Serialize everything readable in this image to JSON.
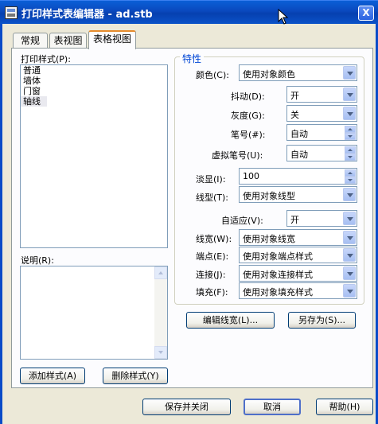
{
  "window": {
    "title": "打印样式表编辑器 - ad.stb",
    "help_glyph": "X"
  },
  "tabs": [
    {
      "label": "常规"
    },
    {
      "label": "表视图"
    },
    {
      "label": "表格视图",
      "active": true
    }
  ],
  "styles_panel": {
    "label": "打印样式(P):",
    "items": [
      "普通",
      "墙体",
      "门窗",
      "轴线"
    ],
    "selected": "轴线",
    "description_label": "说明(R):",
    "add_button": "添加样式(A)",
    "delete_button": "删除样式(Y)"
  },
  "properties": {
    "group_title": "特性",
    "color": {
      "label": "颜色(C):",
      "value": "使用对象颜色"
    },
    "dither": {
      "label": "抖动(D):",
      "value": "开"
    },
    "grayscale": {
      "label": "灰度(G):",
      "value": "关"
    },
    "pen_number": {
      "label": "笔号(#):",
      "value": "自动"
    },
    "virtual_pen": {
      "label": "虚拟笔号(U):",
      "value": "自动"
    },
    "screening": {
      "label": "淡显(I):",
      "value": "100"
    },
    "linetype": {
      "label": "线型(T):",
      "value": "使用对象线型"
    },
    "adaptive": {
      "label": "自适应(V):",
      "value": "开"
    },
    "lineweight": {
      "label": "线宽(W):",
      "value": "使用对象线宽"
    },
    "endpoint": {
      "label": "端点(E):",
      "value": "使用对象端点样式"
    },
    "join": {
      "label": "连接(J):",
      "value": "使用对象连接样式"
    },
    "fill": {
      "label": "填充(F):",
      "value": "使用对象填充样式"
    }
  },
  "actions": {
    "edit_lineweights": "编辑线宽(L)...",
    "save_as": "另存为(S)..."
  },
  "footer": {
    "save_close": "保存并关闭",
    "cancel": "取消",
    "help": "帮助(H)"
  },
  "colors": {
    "titlebar": "#0a4bc8",
    "dialog_bg": "#ece9d8",
    "panel_bg": "#fcfcfe",
    "group_title": "#0046d5",
    "active_tab_accent": "#e68b2c"
  }
}
